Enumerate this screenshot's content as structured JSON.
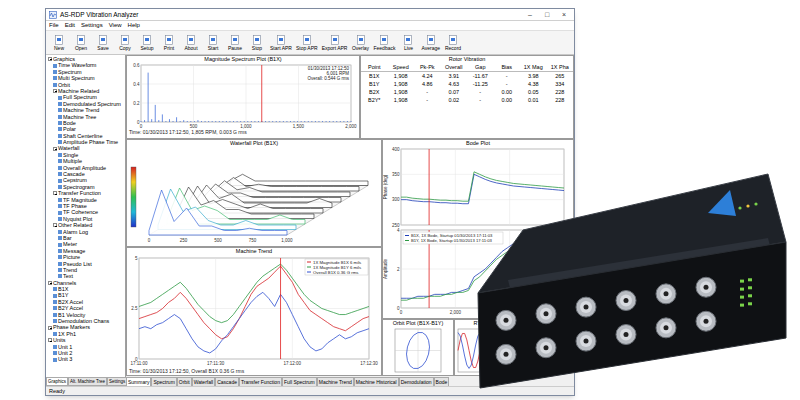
{
  "window": {
    "title": "AS-RDP Vibration Analyzer",
    "controls": [
      "–",
      "□",
      "×"
    ]
  },
  "menu": [
    "File",
    "Edit",
    "Settings",
    "View",
    "Help"
  ],
  "toolbar": [
    "New",
    "Open",
    "Save",
    "Copy",
    "Setup",
    "Print",
    "About",
    "Start",
    "Pause",
    "Stop",
    "Start APR",
    "Stop APR",
    "Export APR",
    "Overlay",
    "Feedback",
    "Live",
    "Average",
    "Record"
  ],
  "tree": [
    {
      "label": "Graphics",
      "level": 0,
      "kind": "group",
      "expanded": true
    },
    {
      "label": "Time Waveform",
      "level": 1,
      "kind": "leaf",
      "expanded": false
    },
    {
      "label": "Spectrum",
      "level": 1,
      "kind": "leaf",
      "expanded": false
    },
    {
      "label": "Multi Spectrum",
      "level": 1,
      "kind": "leaf",
      "expanded": false
    },
    {
      "label": "Orbit",
      "level": 1,
      "kind": "leaf",
      "expanded": false
    },
    {
      "label": "Machine Related",
      "level": 1,
      "kind": "group",
      "expanded": true
    },
    {
      "label": "Full Spectrum",
      "level": 2,
      "kind": "leaf",
      "expanded": false
    },
    {
      "label": "Demodulated Spectrum",
      "level": 2,
      "kind": "leaf",
      "expanded": false
    },
    {
      "label": "Machine Trend",
      "level": 2,
      "kind": "leaf",
      "expanded": false
    },
    {
      "label": "Machine Tree",
      "level": 2,
      "kind": "leaf",
      "expanded": false
    },
    {
      "label": "Bode",
      "level": 2,
      "kind": "leaf",
      "expanded": false
    },
    {
      "label": "Polar",
      "level": 2,
      "kind": "leaf",
      "expanded": false
    },
    {
      "label": "Shaft Centerline",
      "level": 2,
      "kind": "leaf",
      "expanded": false
    },
    {
      "label": "Amplitude Phase Time",
      "level": 2,
      "kind": "leaf",
      "expanded": false
    },
    {
      "label": "Waterfall",
      "level": 1,
      "kind": "group",
      "expanded": true
    },
    {
      "label": "Single",
      "level": 2,
      "kind": "leaf",
      "expanded": false
    },
    {
      "label": "Multiple",
      "level": 2,
      "kind": "leaf",
      "expanded": false
    },
    {
      "label": "Overall Amplitude",
      "level": 2,
      "kind": "leaf",
      "expanded": false
    },
    {
      "label": "Cascade",
      "level": 2,
      "kind": "leaf",
      "expanded": false
    },
    {
      "label": "Cepstrum",
      "level": 2,
      "kind": "leaf",
      "expanded": false
    },
    {
      "label": "Spectrogram",
      "level": 2,
      "kind": "leaf",
      "expanded": false
    },
    {
      "label": "Transfer Function",
      "level": 1,
      "kind": "group",
      "expanded": true
    },
    {
      "label": "TF Magnitude",
      "level": 2,
      "kind": "leaf",
      "expanded": false
    },
    {
      "label": "TF Phase",
      "level": 2,
      "kind": "leaf",
      "expanded": false
    },
    {
      "label": "TF Coherence",
      "level": 2,
      "kind": "leaf",
      "expanded": false
    },
    {
      "label": "Nyquist Plot",
      "level": 2,
      "kind": "leaf",
      "expanded": false
    },
    {
      "label": "Other Related",
      "level": 1,
      "kind": "group",
      "expanded": true
    },
    {
      "label": "Alarm Log",
      "level": 2,
      "kind": "leaf",
      "expanded": false
    },
    {
      "label": "Bar",
      "level": 2,
      "kind": "leaf",
      "expanded": false
    },
    {
      "label": "Meter",
      "level": 2,
      "kind": "leaf",
      "expanded": false
    },
    {
      "label": "Message",
      "level": 2,
      "kind": "leaf",
      "expanded": false
    },
    {
      "label": "Picture",
      "level": 2,
      "kind": "leaf",
      "expanded": false
    },
    {
      "label": "Pseudo List",
      "level": 2,
      "kind": "leaf",
      "expanded": false
    },
    {
      "label": "Trend",
      "level": 2,
      "kind": "leaf",
      "expanded": false
    },
    {
      "label": "Text",
      "level": 2,
      "kind": "leaf",
      "expanded": false
    },
    {
      "label": "Channels",
      "level": 0,
      "kind": "group",
      "expanded": true
    },
    {
      "label": "B1X",
      "level": 1,
      "kind": "leaf",
      "expanded": false
    },
    {
      "label": "B1Y",
      "level": 1,
      "kind": "leaf",
      "expanded": false
    },
    {
      "label": "B2X Accel",
      "level": 1,
      "kind": "leaf",
      "expanded": false
    },
    {
      "label": "B2Y Accel",
      "level": 1,
      "kind": "leaf",
      "expanded": false
    },
    {
      "label": "B1 Velocity",
      "level": 1,
      "kind": "leaf",
      "expanded": false
    },
    {
      "label": "Demodulation Chans",
      "level": 1,
      "kind": "leaf",
      "expanded": false
    },
    {
      "label": "Phase Markers",
      "level": 0,
      "kind": "group",
      "expanded": true
    },
    {
      "label": "1X Ph1",
      "level": 1,
      "kind": "leaf",
      "expanded": false
    },
    {
      "label": "Units",
      "level": 0,
      "kind": "group",
      "expanded": true
    },
    {
      "label": "Unit 1",
      "level": 1,
      "kind": "leaf",
      "expanded": false
    },
    {
      "label": "Unit 2",
      "level": 1,
      "kind": "leaf",
      "expanded": false
    },
    {
      "label": "Unit 3",
      "level": 1,
      "kind": "leaf",
      "expanded": false
    }
  ],
  "left_tabs": [
    {
      "label": "Graphics",
      "selected": true
    },
    {
      "label": "Alt. Machine Tree",
      "selected": false
    },
    {
      "label": "Settings",
      "selected": false
    }
  ],
  "spectrum": {
    "title": "Magnitude Spectrum Plot (B1X)",
    "info": [
      "01/30/2013 17:12:50",
      "6,001 RPM",
      "Overall: 0.544 G rms"
    ],
    "x_ticks": [
      "0",
      "500",
      "1,000",
      "1,500",
      "2,000"
    ],
    "y_ticks": [
      "0",
      "0.2",
      "0.4",
      "0.6"
    ],
    "cursor": 1150,
    "cursor_text": "Time: 01/30/2013 17:12:50, 1,805 RPM, 0.003 G rms",
    "values": [
      0.01,
      0.02,
      0.52,
      0.03,
      0.18,
      0.02,
      0.08,
      0.01,
      0.03,
      0.01,
      0.05,
      0.01,
      0.02,
      0.01,
      0.01,
      0.01,
      0.02,
      0.01,
      0.01,
      0.01,
      0.01,
      0.01,
      0.01,
      0.01,
      0.01,
      0.01,
      0.01,
      0.01,
      0.01,
      0.01,
      0.01,
      0.01,
      0.01,
      0.01,
      0.01,
      0.01,
      0.01,
      0.01,
      0.01,
      0.01,
      0.01,
      0.01,
      0.01,
      0.01,
      0.01,
      0.01,
      0.01,
      0.01,
      0.01,
      0.01,
      0.01,
      0.01,
      0.01,
      0.01,
      0.01,
      0.01,
      0.01,
      0.01,
      0.01,
      0.01
    ]
  },
  "rotor": {
    "title": "Rotor Vibration",
    "columns": [
      "Point",
      "Speed",
      "Pk-Pk",
      "Overall",
      "Gap",
      "Bias",
      "1X Mag",
      "1X Pha"
    ],
    "rows": [
      [
        "B1X",
        "1,908",
        "4.24",
        "3.91",
        "-11.67",
        "-",
        "3.98",
        "265"
      ],
      [
        "B1Y",
        "1,908",
        "4.86",
        "4.63",
        "-11.25",
        "-",
        "4.38",
        "334"
      ],
      [
        "B2X",
        "1,908",
        "-",
        "0.07",
        "-",
        "0.00",
        "0.05",
        "228"
      ],
      [
        "B2Y*",
        "1,908",
        "-",
        "0.02",
        "-",
        "0.00",
        "0.01",
        "228"
      ]
    ]
  },
  "waterfall": {
    "title": "Waterfall Plot (B1X)",
    "x_ticks": [
      "0",
      "250",
      "500",
      "750",
      "1,000"
    ],
    "slices": [
      [
        0.1,
        1.0,
        0.3,
        0.6,
        0.2,
        0.2,
        0.1,
        0.1,
        0.15,
        0.1,
        0.1,
        0.1
      ],
      [
        0.1,
        0.9,
        0.4,
        0.5,
        0.2,
        0.1,
        0.1,
        0.2,
        0.1,
        0.1,
        0.1,
        0.1
      ],
      [
        0.1,
        0.8,
        0.3,
        0.4,
        0.3,
        0.1,
        0.1,
        0.1,
        0.1,
        0.2,
        0.1,
        0.1
      ],
      [
        0.1,
        0.7,
        0.3,
        0.4,
        0.2,
        0.2,
        0.1,
        0.1,
        0.1,
        0.1,
        0.1,
        0.1
      ],
      [
        0.1,
        0.6,
        0.2,
        0.3,
        0.2,
        0.1,
        0.2,
        0.1,
        0.1,
        0.1,
        0.1,
        0.1
      ],
      [
        0.1,
        0.5,
        0.2,
        0.3,
        0.1,
        0.1,
        0.1,
        0.1,
        0.1,
        0.1,
        0.2,
        0.1
      ],
      [
        0.1,
        0.4,
        0.2,
        0.2,
        0.1,
        0.1,
        0.1,
        0.1,
        0.1,
        0.1,
        0.1,
        0.1
      ],
      [
        0.1,
        0.35,
        0.15,
        0.2,
        0.1,
        0.1,
        0.1,
        0.1,
        0.1,
        0.1,
        0.1,
        0.1
      ],
      [
        0.1,
        0.3,
        0.1,
        0.15,
        0.1,
        0.1,
        0.1,
        0.1,
        0.1,
        0.1,
        0.1,
        0.1
      ],
      [
        0.1,
        0.25,
        0.1,
        0.1,
        0.1,
        0.1,
        0.1,
        0.1,
        0.1,
        0.1,
        0.1,
        0.1
      ]
    ]
  },
  "bode": {
    "title": "Bode Plot",
    "phase_label": "Phase (deg)",
    "amp_label": "Amplitude",
    "x_ticks": [
      "0",
      "2,000",
      "4,000",
      "6,000"
    ],
    "phase_ticks": [
      "250",
      "300",
      "350",
      "400"
    ],
    "amp_ticks": [
      "0",
      "2",
      "4"
    ],
    "cursor": 5,
    "phase": [
      {
        "color": "#1f3fb8",
        "values": [
          300,
          300,
          298,
          297,
          296,
          296,
          295,
          294,
          294,
          293,
          293,
          292,
          292,
          350,
          345,
          340,
          336,
          333,
          331,
          329,
          327,
          326,
          325,
          324,
          323,
          322,
          321,
          320,
          319,
          318
        ]
      },
      {
        "color": "#2e9a45",
        "values": [
          305,
          305,
          303,
          302,
          301,
          301,
          300,
          299,
          299,
          298,
          298,
          297,
          297,
          355,
          350,
          345,
          341,
          338,
          336,
          334,
          332,
          331,
          330,
          329,
          328,
          327,
          326,
          325,
          324,
          323
        ]
      }
    ],
    "amplitude": [
      {
        "label": "B1X, 1X Bode, Startup 01/30/2013 17:11:03",
        "color": "#1f3fb8",
        "values": [
          0.5,
          0.5,
          0.5,
          0.6,
          0.6,
          0.6,
          0.7,
          0.7,
          0.7,
          0.8,
          0.8,
          0.9,
          1.0,
          1.6,
          1.8,
          2.0,
          2.3,
          2.6,
          2.9,
          3.1,
          3.3,
          3.4,
          3.4,
          3.3,
          3.2,
          3.0,
          2.9,
          2.8,
          2.8,
          2.7
        ]
      },
      {
        "label": "B1Y, 1X Bode, Startup 01/30/2013 17:11:03",
        "color": "#2e9a45",
        "values": [
          0.4,
          0.4,
          0.5,
          0.5,
          0.5,
          0.6,
          0.6,
          0.6,
          0.7,
          0.7,
          0.8,
          0.8,
          0.9,
          1.4,
          1.6,
          1.9,
          2.2,
          2.5,
          2.7,
          2.9,
          3.1,
          3.2,
          3.2,
          3.1,
          3.0,
          2.9,
          2.8,
          2.7,
          2.6,
          2.6
        ]
      }
    ]
  },
  "trend": {
    "title": "Machine Trend",
    "x_ticks": [
      "17:11:00",
      "17:11:30",
      "17:12:00",
      "17:12:30"
    ],
    "y_ticks": [
      "0",
      "2.5",
      "5"
    ],
    "cursor": 24,
    "cursor_text": "Time: 01/30/2013 17:12:50, Overall B1X 0.36 G rms",
    "series": [
      {
        "label": "1X Magnitude B1X 6 mils",
        "color": "#d6262b",
        "values": [
          2.0,
          2.1,
          2.2,
          2.3,
          2.5,
          2.8,
          3.0,
          3.3,
          3.0,
          2.6,
          2.2,
          1.8,
          1.5,
          1.2,
          1.0,
          1.1,
          1.5,
          2.0,
          2.6,
          3.2,
          3.6,
          3.8,
          4.0,
          4.3,
          4.6,
          4.2,
          3.8,
          3.2,
          2.8,
          2.4,
          2.2,
          2.0,
          1.8,
          1.6,
          1.5,
          1.4,
          1.6,
          1.8,
          2.0,
          2.1
        ]
      },
      {
        "label": "1X Magnitude B1Y 6 mils",
        "color": "#2e9a45",
        "values": [
          2.6,
          2.7,
          2.8,
          3.0,
          3.2,
          3.4,
          3.6,
          3.8,
          3.5,
          3.1,
          2.7,
          2.4,
          2.1,
          1.9,
          1.8,
          1.9,
          2.2,
          2.6,
          3.0,
          3.4,
          3.8,
          4.1,
          4.3,
          4.5,
          4.7,
          4.4,
          4.0,
          3.6,
          3.2,
          2.9,
          2.7,
          2.5,
          2.4,
          2.3,
          2.2,
          2.2,
          2.3,
          2.4,
          2.5,
          2.6
        ]
      },
      {
        "label": "Overall B1X 0.36 G rms",
        "color": "#2f4fd0",
        "values": [
          1.5,
          1.6,
          1.5,
          1.7,
          1.8,
          2.0,
          2.2,
          2.0,
          1.5,
          1.0,
          0.6,
          0.4,
          0.3,
          0.5,
          0.9,
          1.2,
          1.6,
          2.0,
          2.4,
          2.8,
          3.1,
          3.3,
          3.0,
          2.6,
          3.2,
          2.8,
          2.2,
          1.6,
          1.0,
          0.6,
          0.4,
          0.5,
          0.8,
          1.0,
          1.2,
          1.0,
          1.1,
          1.3,
          1.4,
          1.5
        ]
      }
    ]
  },
  "orbit": {
    "title": "Orbit Plot (B1X-B1Y)",
    "x": [
      0.6,
      0.55,
      0.42,
      0.23,
      0,
      -0.23,
      -0.42,
      -0.55,
      -0.6,
      -0.55,
      -0.42,
      -0.23,
      0,
      0.23,
      0.42,
      0.55
    ],
    "y": [
      0.2,
      0.57,
      0.85,
      1.0,
      1.0,
      0.85,
      0.57,
      0.2,
      -0.2,
      -0.57,
      -0.85,
      -1.0,
      -1.0,
      -0.85,
      -0.57,
      -0.2
    ]
  },
  "rtp": {
    "title": "RTP",
    "waves": [
      {
        "color": "#d6262b",
        "values": [
          0,
          0.59,
          0.95,
          0.95,
          0.59,
          0,
          -0.59,
          -0.95,
          -0.95,
          -0.59,
          0,
          0.59,
          0.95,
          0.95,
          0.59,
          0,
          -0.59,
          -0.95,
          -0.95,
          -0.59
        ]
      },
      {
        "color": "#2f4fd0",
        "values": [
          1,
          0.81,
          0.31,
          -0.31,
          -0.81,
          -1,
          -0.81,
          -0.31,
          0.31,
          0.81,
          1,
          0.81,
          0.31,
          -0.31,
          -0.81,
          -1,
          -0.81,
          -0.31,
          0.31,
          0.81
        ]
      }
    ]
  },
  "pages": [
    {
      "label": "Summary",
      "selected": true
    },
    {
      "label": "Spectrum",
      "selected": false
    },
    {
      "label": "Orbit",
      "selected": false
    },
    {
      "label": "Waterfall",
      "selected": false
    },
    {
      "label": "Cascade",
      "selected": false
    },
    {
      "label": "Transfer Function",
      "selected": false
    },
    {
      "label": "Full Spectrum",
      "selected": false
    },
    {
      "label": "Machine Trend",
      "selected": false
    },
    {
      "label": "Machine Historical",
      "selected": false
    },
    {
      "label": "Demodulation",
      "selected": false
    },
    {
      "label": "Bode",
      "selected": false
    }
  ],
  "status": "Ready"
}
